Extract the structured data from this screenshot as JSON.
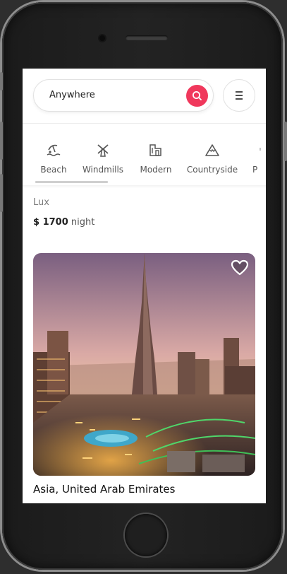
{
  "search": {
    "value": "Anywhere"
  },
  "categories": [
    {
      "label": "Beach",
      "icon": "beach-icon"
    },
    {
      "label": "Windmills",
      "icon": "windmill-icon"
    },
    {
      "label": "Modern",
      "icon": "modern-building-icon"
    },
    {
      "label": "Countryside",
      "icon": "mountain-icon"
    },
    {
      "label": "P",
      "icon": "pool-icon"
    }
  ],
  "previous_listing": {
    "name": "Lux",
    "price": "$ 1700",
    "unit": "night"
  },
  "listing": {
    "title": "Asia, United Arab Emirates"
  },
  "colors": {
    "accent": "#f0385c"
  }
}
